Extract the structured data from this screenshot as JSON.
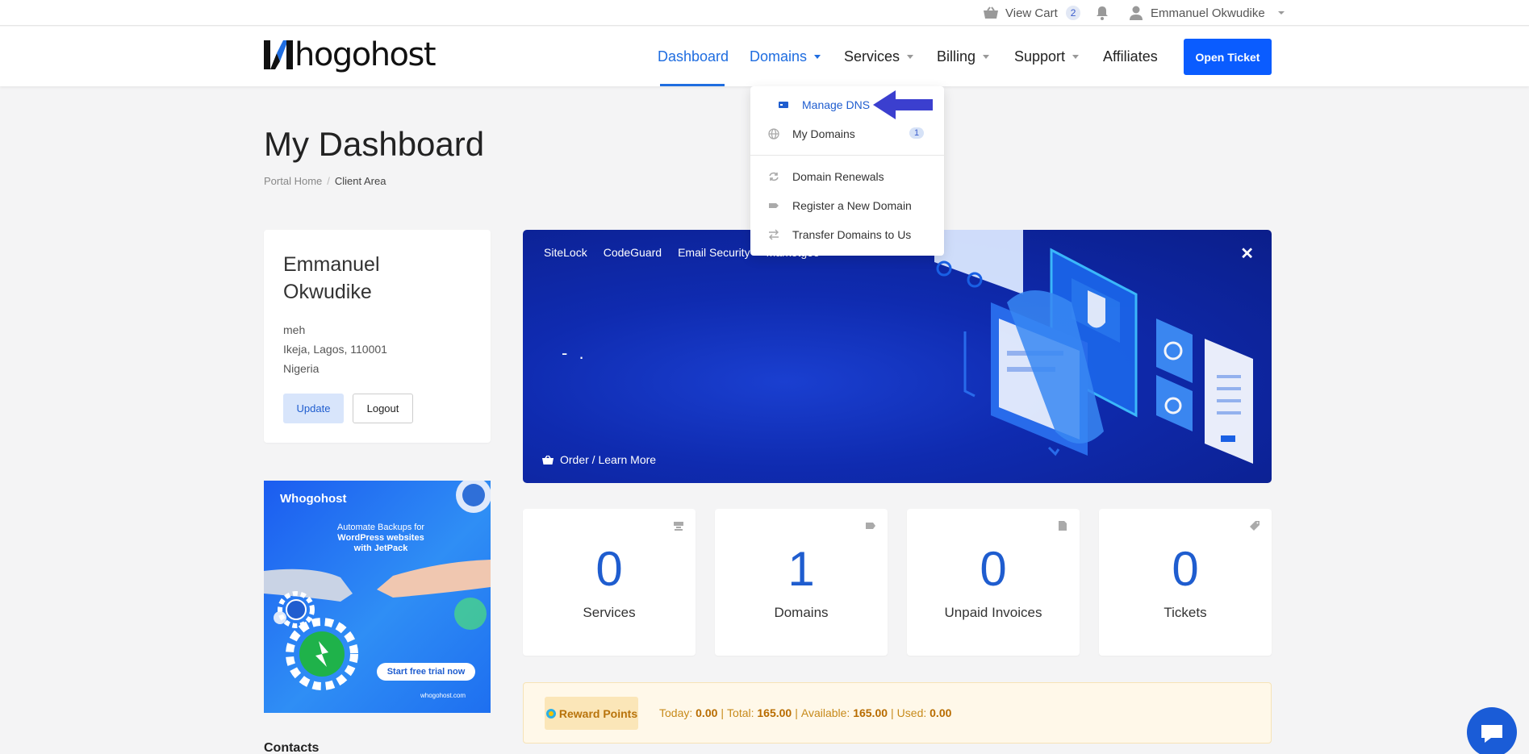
{
  "topbar": {
    "cart_label": "View Cart",
    "cart_count": "2",
    "user_name": "Emmanuel Okwudike"
  },
  "nav": {
    "logo_text": "hogohost",
    "items": [
      {
        "label": "Dashboard"
      },
      {
        "label": "Domains"
      },
      {
        "label": "Services"
      },
      {
        "label": "Billing"
      },
      {
        "label": "Support"
      },
      {
        "label": "Affiliates"
      }
    ],
    "cta_label": "Open Ticket"
  },
  "dropdown": {
    "items": [
      {
        "label": "Manage DNS",
        "icon": "dns-icon"
      },
      {
        "label": "My Domains",
        "icon": "globe-icon",
        "badge": "1"
      },
      {
        "label": "Domain Renewals",
        "icon": "refresh-icon"
      },
      {
        "label": "Register a New Domain",
        "icon": "tag-icon"
      },
      {
        "label": "Transfer Domains to Us",
        "icon": "transfer-icon"
      }
    ]
  },
  "page": {
    "title": "My Dashboard",
    "breadcrumb": [
      "Portal Home",
      "Client Area"
    ]
  },
  "profile": {
    "name_line1": "Emmanuel",
    "name_line2": "Okwudike",
    "company": "meh",
    "city_line": "Ikeja, Lagos, 110001",
    "country": "Nigeria",
    "update_label": "Update",
    "logout_label": "Logout"
  },
  "promo": {
    "brand": "hogohost",
    "line1": "Automate Backups for",
    "line2": "WordPress websites",
    "line3": "with JetPack",
    "cta": "Start free trial now",
    "url": "whogohost.com"
  },
  "hero": {
    "tabs": [
      "SiteLock",
      "CodeGuard",
      "Email Security",
      "Marketgoo"
    ],
    "placeholder": "- .",
    "order_label": "Order / Learn More",
    "close_glyph": "✕"
  },
  "stats": [
    {
      "value": "0",
      "label": "Services",
      "icon": "server-icon"
    },
    {
      "value": "1",
      "label": "Domains",
      "icon": "tag-icon"
    },
    {
      "value": "0",
      "label": "Unpaid Invoices",
      "icon": "document-icon"
    },
    {
      "value": "0",
      "label": "Tickets",
      "icon": "ticket-icon"
    }
  ],
  "rewards": {
    "label": "Reward Points",
    "today_label": "Today:",
    "today": "0.00",
    "total_label": "Total:",
    "total": "165.00",
    "available_label": "Available:",
    "available": "165.00",
    "used_label": "Used:",
    "used": "0.00"
  },
  "contacts": {
    "heading": "Contacts"
  },
  "colors": {
    "primary": "#1f6de0",
    "cta": "#0a5cff",
    "annotation_arrow": "#3b3fcf",
    "reward_text": "#c78a1a"
  }
}
